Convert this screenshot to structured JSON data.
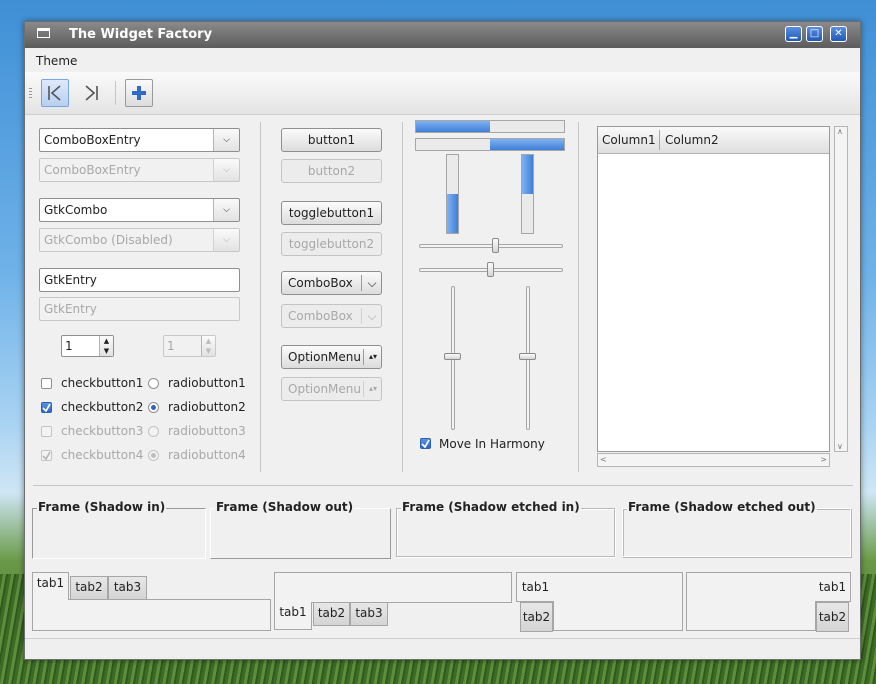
{
  "window": {
    "title": "The Widget Factory"
  },
  "menu": {
    "theme": "Theme"
  },
  "colors": {
    "accent": "#3f7fd9",
    "titlebar": "#6f6f6f",
    "window_bg": "#f0f0f0"
  },
  "toolbar": {
    "icons": [
      "first-icon",
      "last-icon",
      "add-icon"
    ]
  },
  "left": {
    "comboentry1": "ComboBoxEntry",
    "comboentry2": "ComboBoxEntry",
    "gtkcombo1": "GtkCombo",
    "gtkcombo2": "GtkCombo (Disabled)",
    "entry1": "GtkEntry",
    "entry2": "GtkEntry",
    "spin1": "1",
    "spin2": "1",
    "checks": [
      "checkbutton1",
      "checkbutton2",
      "checkbutton3",
      "checkbutton4"
    ],
    "radios": [
      "radiobutton1",
      "radiobutton2",
      "radiobutton3",
      "radiobutton4"
    ]
  },
  "buttons": {
    "button1": "button1",
    "button2": "button2",
    "toggle1": "togglebutton1",
    "toggle2": "togglebutton2",
    "combobox1": "ComboBox",
    "combobox2": "ComboBox",
    "optionmenu1": "OptionMenu",
    "optionmenu2": "OptionMenu"
  },
  "ranges": {
    "progress_h1": 0.5,
    "progress_h2": 0.5,
    "progress_v1": 0.5,
    "progress_v2": 0.5,
    "move_in_harmony": "Move In Harmony"
  },
  "tree": {
    "col1": "Column1",
    "col2": "Column2"
  },
  "frames": [
    "Frame (Shadow in)",
    "Frame (Shadow out)",
    "Frame (Shadow etched in)",
    "Frame (Shadow etched out)"
  ],
  "tabs": [
    "tab1",
    "tab2",
    "tab3"
  ]
}
